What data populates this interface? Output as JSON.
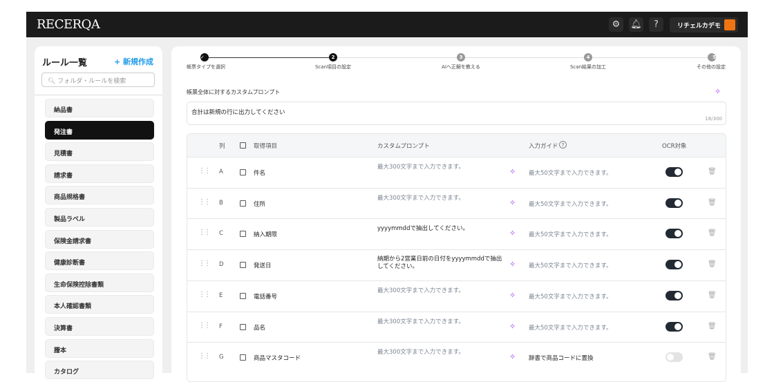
{
  "app": {
    "logo": "RECERQA",
    "user": "リチェルカデモ",
    "accent": "#f07413"
  },
  "sidebar": {
    "title": "ルール一覧",
    "new_label": "+ 新規作成",
    "search_placeholder": "フォルダ・ルールを検索",
    "items": [
      "納品書",
      "発注書",
      "見積書",
      "請求書",
      "商品規格書",
      "製品ラベル",
      "保険金請求書",
      "健康診断書",
      "生命保険控除書類",
      "本人確認書類",
      "決算書",
      "謄本",
      "カタログ"
    ],
    "active_index": 1
  },
  "steps": [
    {
      "num": "✓",
      "label": "帳票タイプを選択",
      "state": "done"
    },
    {
      "num": "2",
      "label": "Scan項目の設定",
      "state": "current"
    },
    {
      "num": "3",
      "label": "AIへ正解を教える",
      "state": "todo"
    },
    {
      "num": "4",
      "label": "Scan結果の加工",
      "state": "todo"
    },
    {
      "num": "5",
      "label": "その他の設定",
      "state": "todo"
    }
  ],
  "custom_prompt": {
    "label": "帳票全体に対するカスタムプロンプト",
    "value": "合計は新規の行に出力してください",
    "count": "16/300"
  },
  "table": {
    "headers": {
      "col": "列",
      "item": "取得項目",
      "prompt": "カスタムプロンプト",
      "guide": "入力ガイド",
      "ocr": "OCR対象"
    },
    "rows": [
      {
        "col": "A",
        "item": "件名",
        "prompt": "最大300文字まで入力できます。",
        "prompt_placeholder": true,
        "guide": "最大50文字まで入力できます。",
        "guide_placeholder": true,
        "ocr": true
      },
      {
        "col": "B",
        "item": "住所",
        "prompt": "最大300文字まで入力できます。",
        "prompt_placeholder": true,
        "guide": "最大50文字まで入力できます。",
        "guide_placeholder": true,
        "ocr": true
      },
      {
        "col": "C",
        "item": "納入期限",
        "prompt": "yyyymmddで抽出してください。",
        "prompt_placeholder": false,
        "guide": "最大50文字まで入力できます。",
        "guide_placeholder": true,
        "ocr": true
      },
      {
        "col": "D",
        "item": "発送日",
        "prompt": "納期から2営業日前の日付をyyyymmddで抽出してください。",
        "prompt_placeholder": false,
        "guide": "最大50文字まで入力できます。",
        "guide_placeholder": true,
        "ocr": true
      },
      {
        "col": "E",
        "item": "電話番号",
        "prompt": "最大300文字まで入力できます。",
        "prompt_placeholder": true,
        "guide": "最大50文字まで入力できます。",
        "guide_placeholder": true,
        "ocr": true
      },
      {
        "col": "F",
        "item": "品名",
        "prompt": "最大300文字まで入力できます。",
        "prompt_placeholder": true,
        "guide": "最大50文字まで入力できます。",
        "guide_placeholder": true,
        "ocr": true
      },
      {
        "col": "G",
        "item": "商品マスタコード",
        "prompt": "最大300文字まで入力できます。",
        "prompt_placeholder": true,
        "guide": "辞書で商品コードに置換",
        "guide_placeholder": false,
        "ocr": false
      }
    ]
  }
}
